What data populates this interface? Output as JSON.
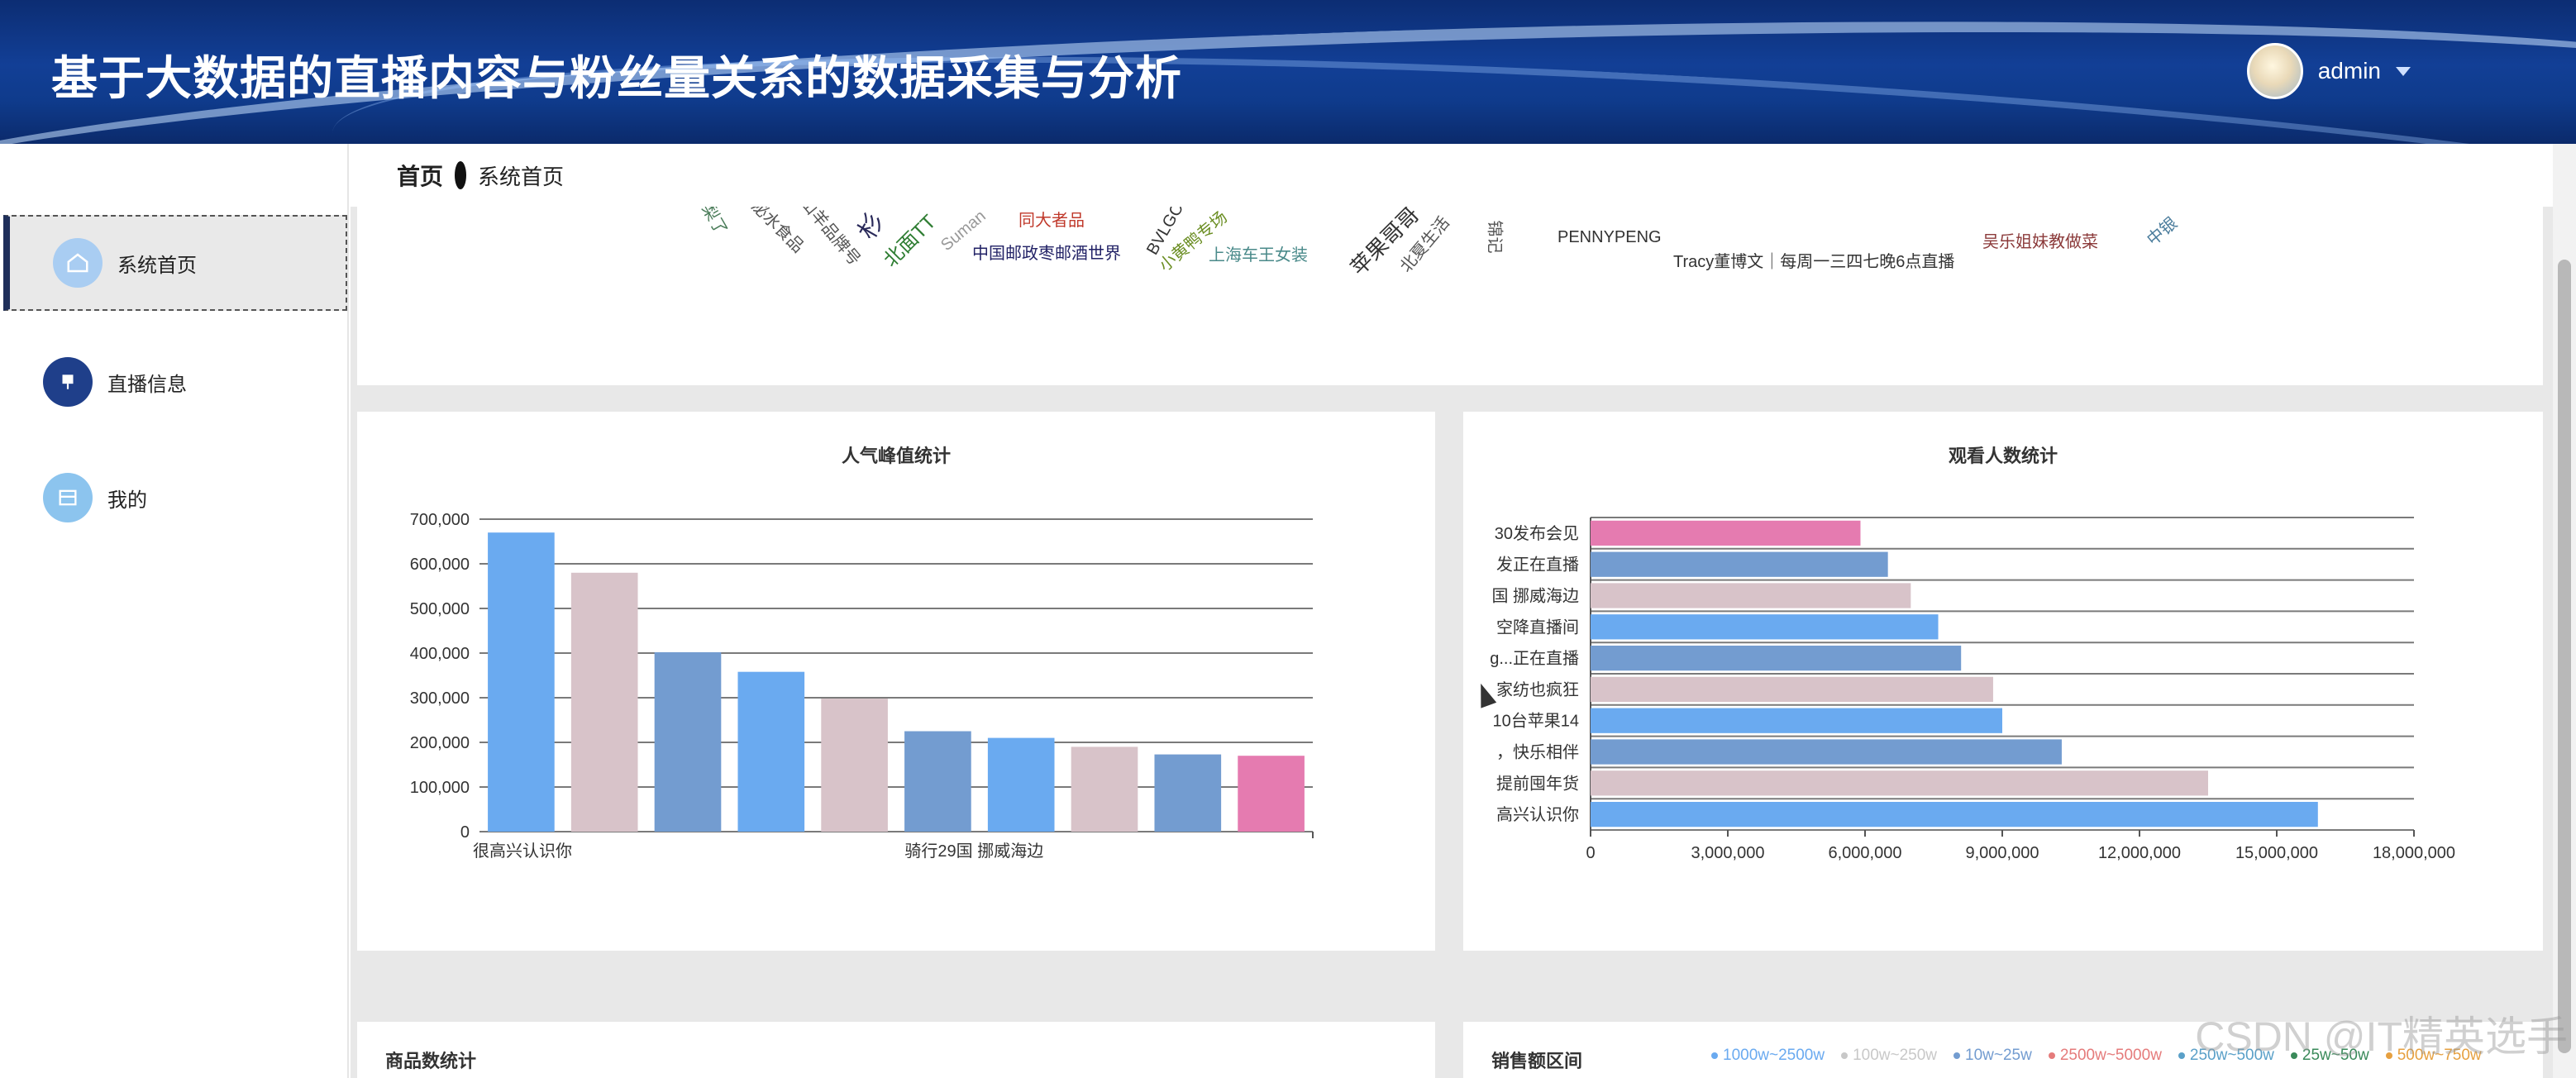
{
  "header": {
    "title": "基于大数据的直播内容与粉丝量关系的数据采集与分析",
    "username": "admin"
  },
  "sidebar": {
    "items": [
      {
        "label": "系统首页",
        "icon": "home-icon",
        "active": true
      },
      {
        "label": "直播信息",
        "icon": "live-icon",
        "active": false
      },
      {
        "label": "我的",
        "icon": "profile-icon",
        "active": false
      }
    ]
  },
  "breadcrumb": {
    "first": "首页",
    "current": "系统首页"
  },
  "wordcloud": {
    "words": [
      {
        "text": "梨了",
        "color": "#4a7c59"
      },
      {
        "text": "泌水食品",
        "color": "#555555"
      },
      {
        "text": "山羊品牌号",
        "color": "#555555"
      },
      {
        "text": "杉",
        "color": "#2a2a5a"
      },
      {
        "text": "北面TT",
        "color": "#2e7d32"
      },
      {
        "text": "Suman",
        "color": "#999999"
      },
      {
        "text": "同大者品",
        "color": "#c0392b"
      },
      {
        "text": "中国邮政枣邮酒世界",
        "color": "#222266"
      },
      {
        "text": "小黄鸭专场",
        "color": "#6b8e23"
      },
      {
        "text": "BVLGC",
        "color": "#333333"
      },
      {
        "text": "上海车王女装",
        "color": "#4a8a8a"
      },
      {
        "text": "苹果哥哥",
        "color": "#333333"
      },
      {
        "text": "北夏生活",
        "color": "#555555"
      },
      {
        "text": "锦记",
        "color": "#555555"
      },
      {
        "text": "PENNYPENG",
        "color": "#333333"
      },
      {
        "text": "Tracy董博文｜每周一三四七晚6点直播",
        "color": "#333333"
      },
      {
        "text": "吴乐姐妹教做菜",
        "color": "#8b3a3a"
      },
      {
        "text": "中银",
        "color": "#4a7c9c"
      }
    ]
  },
  "chart1": {
    "title": "人气峰值统计",
    "chart_data": {
      "type": "bar",
      "title": "人气峰值统计",
      "categories": [
        "很高兴认识你",
        "",
        "",
        "",
        "",
        "骑行29国 挪威海边",
        "",
        "",
        "",
        ""
      ],
      "values": [
        670000,
        580000,
        402000,
        358000,
        298000,
        225000,
        210000,
        190000,
        173000,
        170000
      ],
      "colors": [
        "#6aaaf0",
        "#d8c3c9",
        "#739cd0",
        "#6aaaf0",
        "#d8c3c9",
        "#739cd0",
        "#6aaaf0",
        "#d8c3c9",
        "#739cd0",
        "#e57bb0"
      ],
      "ylim": [
        0,
        700000
      ],
      "yticks": [
        "0",
        "100,000",
        "200,000",
        "300,000",
        "400,000",
        "500,000",
        "600,000",
        "700,000"
      ],
      "grid": true
    }
  },
  "chart2": {
    "title": "观看人数统计",
    "chart_data": {
      "type": "bar",
      "orientation": "horizontal",
      "title": "观看人数统计",
      "categories": [
        "30发布会见",
        "发正在直播",
        "国 挪威海边",
        "空降直播间",
        "g...正在直播",
        "家纺也疯狂",
        "10台苹果14",
        "，快乐相伴",
        "提前囤年货",
        "高兴认识你"
      ],
      "values": [
        5900000,
        6500000,
        7000000,
        7600000,
        8100000,
        8800000,
        9000000,
        10300000,
        13500000,
        15900000
      ],
      "colors": [
        "#e57bb0",
        "#739cd0",
        "#d8c3c9",
        "#6aaaf0",
        "#739cd0",
        "#d8c3c9",
        "#6aaaf0",
        "#739cd0",
        "#d8c3c9",
        "#6aaaf0"
      ],
      "xlim": [
        0,
        18000000
      ],
      "xticks": [
        "0",
        "3,000,000",
        "6,000,000",
        "9,000,000",
        "12,000,000",
        "15,000,000",
        "18,000,000"
      ],
      "grid": true
    }
  },
  "bottom": {
    "left_title": "商品数统计",
    "right_title": "销售额区间",
    "legend": [
      {
        "label": "1000w~2500w",
        "color": "#6aaaf0"
      },
      {
        "label": "100w~250w",
        "color": "#c8c8c8"
      },
      {
        "label": "10w~25w",
        "color": "#739cd0"
      },
      {
        "label": "2500w~5000w",
        "color": "#e57b7b"
      },
      {
        "label": "250w~500w",
        "color": "#5aa0c8"
      },
      {
        "label": "25w~50w",
        "color": "#3a8a5a"
      },
      {
        "label": "500w~750w",
        "color": "#e6a040"
      }
    ]
  },
  "watermark": "CSDN @IT精英选手"
}
